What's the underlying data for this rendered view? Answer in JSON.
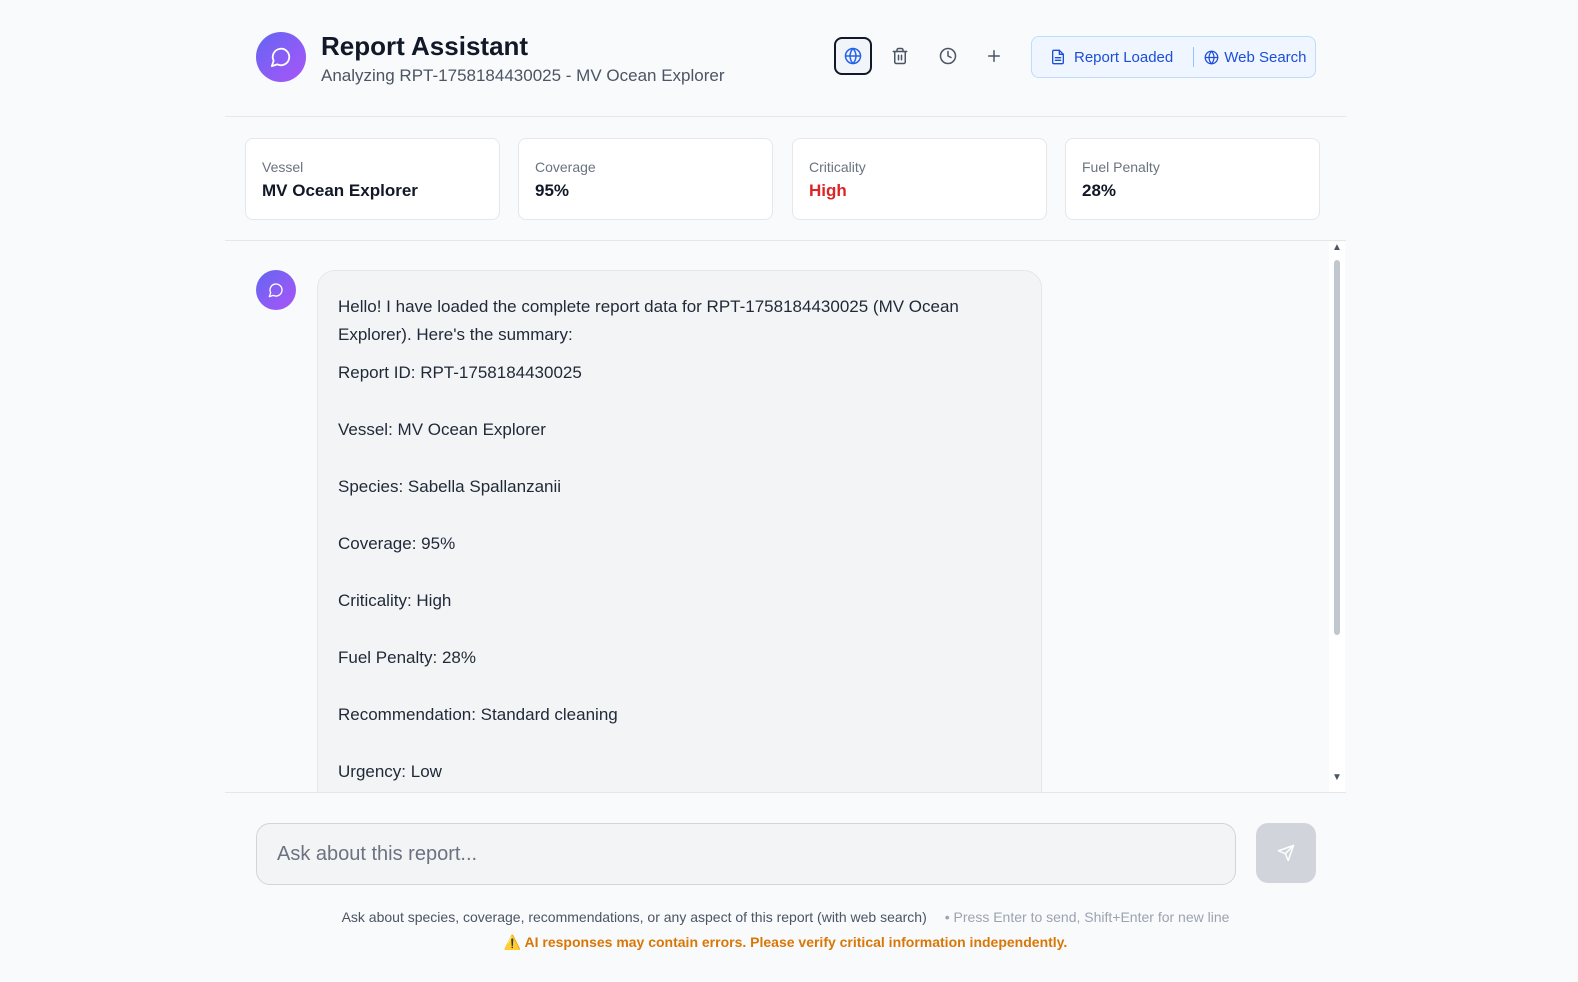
{
  "header": {
    "title": "Report Assistant",
    "subtitle": "Analyzing RPT-1758184430025 - MV Ocean Explorer",
    "status_report": "Report Loaded",
    "status_web": "Web Search"
  },
  "stats": [
    {
      "label": "Vessel",
      "value": "MV Ocean Explorer"
    },
    {
      "label": "Coverage",
      "value": "95%"
    },
    {
      "label": "Criticality",
      "value": "High"
    },
    {
      "label": "Fuel Penalty",
      "value": "28%"
    }
  ],
  "colors": {
    "accent": "#6366f1",
    "criticality_high": "#dc2626",
    "status_blue": "#1d4ed8",
    "warning": "#d97706"
  },
  "message": {
    "intro": "Hello! I have loaded the complete report data for RPT-1758184430025 (MV Ocean Explorer). Here's the summary:",
    "lines": [
      "Report ID: RPT-1758184430025",
      "Vessel: MV Ocean Explorer",
      "Species: Sabella Spallanzanii",
      "Coverage: 95%",
      "Criticality: High",
      "Fuel Penalty: 28%",
      "Recommendation: Standard cleaning",
      "Urgency: Low"
    ]
  },
  "composer": {
    "placeholder": "Ask about this report...",
    "help": "Ask about species, coverage, recommendations, or any aspect of this report (with web search)",
    "hint": "• Press Enter to send, Shift+Enter for new line",
    "warning_icon": "⚠️",
    "warning": "AI responses may contain errors. Please verify critical information independently."
  },
  "icons": [
    "chat-bubble-icon",
    "globe-icon",
    "trash-icon",
    "clock-icon",
    "plus-icon",
    "document-icon",
    "send-icon"
  ]
}
